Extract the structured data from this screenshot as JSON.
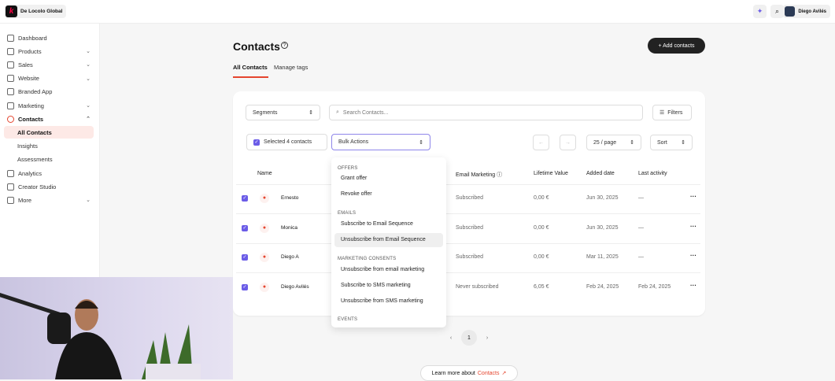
{
  "brand": {
    "name": "De Locolo Global"
  },
  "topbar": {
    "user_name": "Diego Avilés"
  },
  "sidebar": {
    "items": [
      {
        "label": "Dashboard",
        "chev": false
      },
      {
        "label": "Products",
        "chev": true
      },
      {
        "label": "Sales",
        "chev": true
      },
      {
        "label": "Website",
        "chev": true
      },
      {
        "label": "Branded App",
        "chev": false
      },
      {
        "label": "Marketing",
        "chev": true
      },
      {
        "label": "Contacts",
        "chev": true
      },
      {
        "label": "All Contacts",
        "sub": true
      },
      {
        "label": "Insights",
        "sub": true
      },
      {
        "label": "Assessments",
        "sub": true
      },
      {
        "label": "Analytics",
        "chev": false
      },
      {
        "label": "Creator Studio",
        "chev": false
      },
      {
        "label": "More",
        "chev": true
      }
    ]
  },
  "page": {
    "title": "Contacts",
    "add_label": "+ Add contacts",
    "tabs": [
      "All Contacts",
      "Manage tags"
    ]
  },
  "toolbar": {
    "segments": "Segments",
    "search_placeholder": "Search Contacts...",
    "filters": "Filters",
    "selected": "Selected 4 contacts",
    "bulk": "Bulk Actions",
    "per_page": "25 / page",
    "sort": "Sort"
  },
  "table": {
    "headers": [
      "Name",
      "Email Marketing",
      "Lifetime Value",
      "Added date",
      "Last activity"
    ],
    "rows": [
      {
        "name": "Ernesto",
        "email": "Subscribed",
        "ltv": "0,00 €",
        "added": "Jun 30, 2025",
        "last": "—"
      },
      {
        "name": "Monica",
        "email": "Subscribed",
        "ltv": "0,00 €",
        "added": "Jun 30, 2025",
        "last": "—"
      },
      {
        "name": "Diego A",
        "email": "Subscribed",
        "ltv": "0,00 €",
        "added": "Mar 11, 2025",
        "last": "—"
      },
      {
        "name": "Diego Avilés",
        "email": "Never subscribed",
        "ltv": "6,05 €",
        "added": "Feb 24, 2025",
        "last": "Feb 24, 2025"
      }
    ]
  },
  "menu": {
    "offers": "OFFERS",
    "grant": "Grant offer",
    "revoke": "Revoke offer",
    "emails": "EMAILS",
    "sub_seq": "Subscribe to Email Sequence",
    "unsub_seq": "Unsubscribe from Email Sequence",
    "consents": "MARKETING CONSENTS",
    "unsub_email": "Unsubscribe from email marketing",
    "sub_sms": "Subscribe to SMS marketing",
    "unsub_sms": "Unsubscribe from SMS marketing",
    "events": "EVENTS"
  },
  "pagination": {
    "current": "1"
  },
  "learn": {
    "prefix": "Learn more about",
    "link": "Contacts"
  },
  "colors": {
    "accent": "#e5452e",
    "check": "#6b5ce7"
  }
}
